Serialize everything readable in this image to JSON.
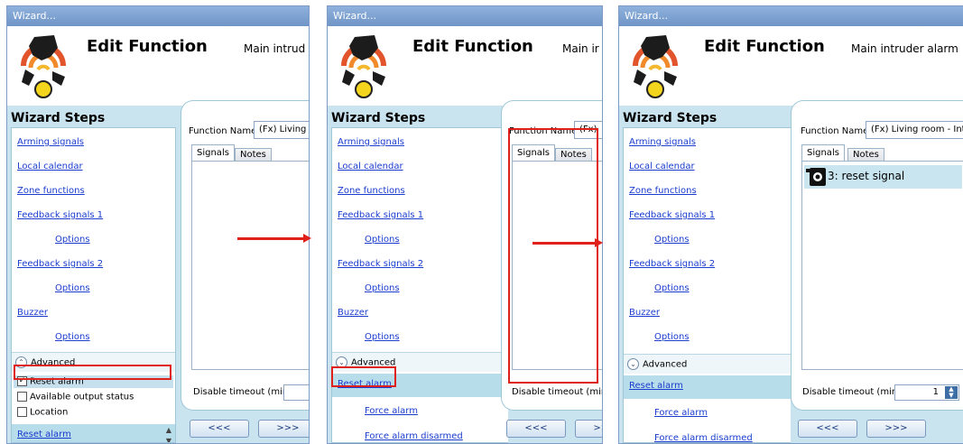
{
  "window": {
    "title": "Wizard..."
  },
  "header": {
    "title": "Edit Function",
    "subtitle_p1": "Main intrud",
    "subtitle_p2": "Main ir",
    "subtitle_p3": "Main intruder alarm"
  },
  "wizard": {
    "title": "Wizard Steps",
    "steps": {
      "arming": "Arming signals",
      "calendar": "Local calendar",
      "zones": "Zone functions",
      "feedback1": "Feedback signals 1",
      "options": "Options",
      "feedback2": "Feedback signals 2",
      "buzzer": "Buzzer"
    },
    "advanced_label": "Advanced",
    "advanced_items": {
      "reset_alarm": "Reset alarm",
      "available_output": "Available output status",
      "location": "Location"
    },
    "selected_step": "Reset alarm",
    "force_alarm": "Force alarm",
    "force_alarm_disarmed": "Force alarm disarmed"
  },
  "content": {
    "function_name_label": "Function Name:",
    "function_name_p1": "(Fx) Living",
    "function_name_p2": "(Fx)",
    "function_name_p3": "(Fx) Living room - Intru",
    "tabs": {
      "signals": "Signals",
      "notes": "Notes"
    },
    "signal_item": "3: reset signal",
    "disable_timeout_label": "Disable timeout (min)",
    "disable_timeout_value": "1"
  },
  "nav": {
    "back": "<<<",
    "next": ">>>"
  },
  "colors": {
    "highlight": "#e0201b",
    "accent": "#c9e3ef",
    "link": "#1a3ccf"
  }
}
